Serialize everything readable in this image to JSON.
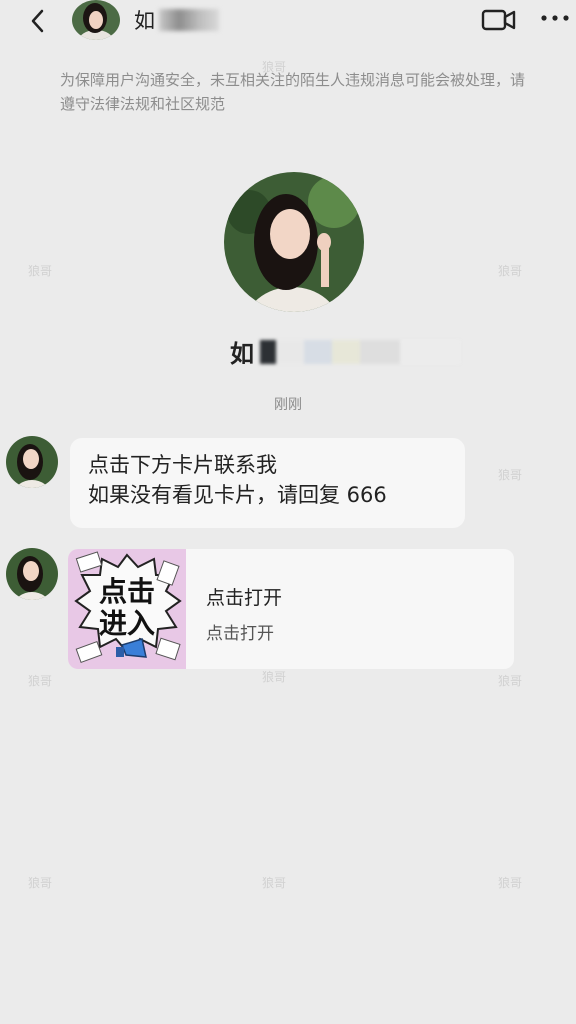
{
  "header": {
    "name_prefix": "如",
    "back_icon": "back-arrow-icon",
    "video_icon": "video-call-icon",
    "more_icon": "more-dots-icon"
  },
  "notice": "为保障用户沟通安全，未互相关注的陌生人违规消息可能会被处理，请遵守法律法规和社区规范",
  "profile": {
    "name_prefix": "如"
  },
  "time": "刚刚",
  "messages": [
    {
      "line1": "点击下方卡片联系我",
      "line2": "如果没有看见卡片，请回复 666"
    }
  ],
  "card": {
    "thumb_text_1": "点击",
    "thumb_text_2": "进入",
    "title": "点击打开",
    "subtitle": "点击打开"
  },
  "watermark": "狼哥",
  "colors": {
    "background": "#ebebeb",
    "bubble": "#f7f7f7",
    "card_thumb_bg": "#e8c8e6",
    "megaphone": "#3a7fd8"
  }
}
